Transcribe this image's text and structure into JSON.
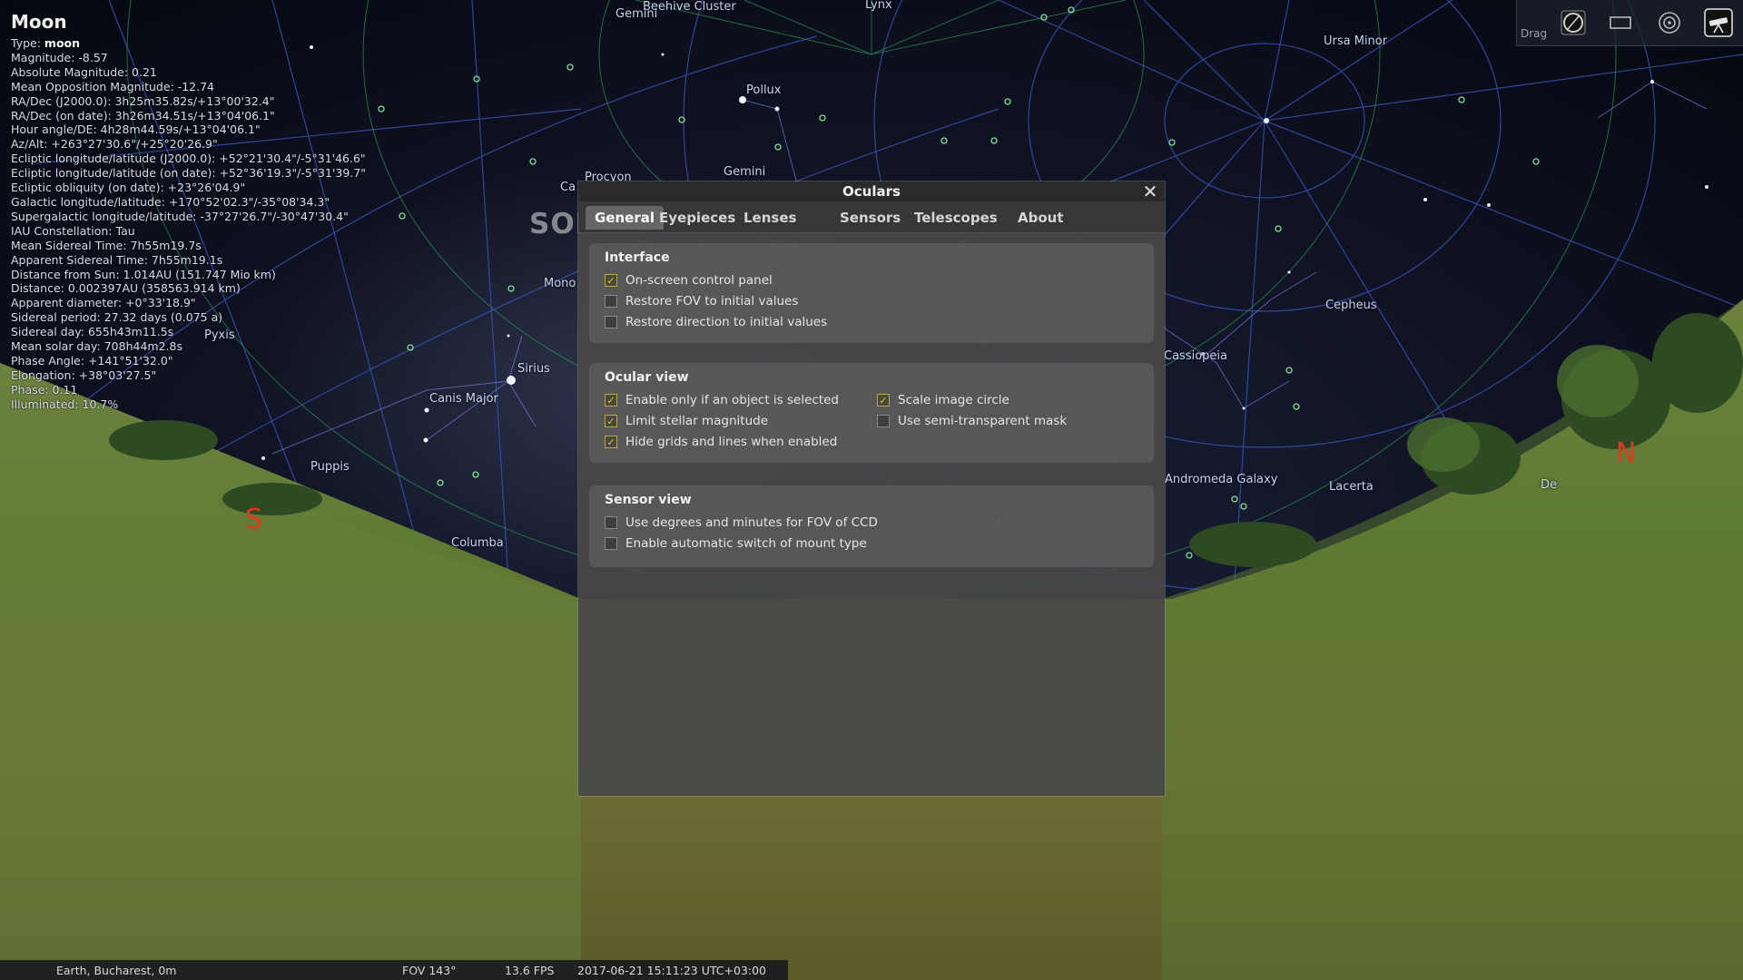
{
  "object_info": {
    "name": "Moon",
    "type_label": "Type:",
    "type_value": "moon",
    "lines": [
      "Magnitude: -8.57",
      "Absolute Magnitude: 0.21",
      "Mean Opposition Magnitude: -12.74",
      "RA/Dec (J2000.0): 3h25m35.82s/+13°00'32.4\"",
      "RA/Dec (on date): 3h26m34.51s/+13°04'06.1\"",
      "Hour angle/DE: 4h28m44.59s/+13°04'06.1\"",
      "Az/Alt: +263°27'30.6\"/+25°20'26.9\"",
      "Ecliptic longitude/latitude (J2000.0): +52°21'30.4\"/-5°31'46.6\"",
      "Ecliptic longitude/latitude (on date): +52°36'19.3\"/-5°31'39.7\"",
      "Ecliptic obliquity (on date): +23°26'04.9\"",
      "Galactic longitude/latitude: +170°52'02.3\"/-35°08'34.3\"",
      "Supergalactic longitude/latitude: -37°27'26.7\"/-30°47'30.4\"",
      "IAU Constellation: Tau",
      "Mean Sidereal Time: 7h55m19.7s",
      "Apparent Sidereal Time: 7h55m19.1s",
      "Distance from Sun: 1.014AU (151.747 Mio km)",
      "Distance: 0.002397AU (358563.914 km)",
      "Apparent diameter: +0°33'18.9\"",
      "Sidereal period: 27.32 days (0.075 a)",
      "Sidereal day: 655h43m11.5s",
      "Mean solar day: 708h44m2.8s",
      "Phase Angle: +141°51'32.0\"",
      "Elongation: +38°03'27.5\"",
      "Phase: 0.11",
      "Illuminated: 10.7%"
    ]
  },
  "toolbar": {
    "drag_label": "Drag",
    "icons": [
      "ocular-icon",
      "sensor-frame-icon",
      "telrad-icon",
      "telescope-icon"
    ]
  },
  "sky_labels": {
    "beehive": "Beehive Cluster",
    "gemini_top": "Gemini",
    "lynx": "Lynx",
    "ursa_minor": "Ursa Minor",
    "pollux": "Pollux",
    "procyon": "Procyon",
    "gemini": "Gemini",
    "cancer": "Ca",
    "monoceros": "Mono",
    "pyxis": "Pyxis",
    "sirius": "Sirius",
    "canis_major": "Canis Major",
    "puppis": "Puppis",
    "columba": "Columba",
    "cepheus": "Cepheus",
    "cassiopeia": "Cassiopeia",
    "andromeda_galaxy": "Andromeda Galaxy",
    "lacerta": "Lacerta",
    "de": "De",
    "south": "S",
    "north": "N"
  },
  "watermark": "SOFTPEDIA",
  "dialog": {
    "title": "Oculars",
    "close_glyph": "✕",
    "tabs": [
      "General",
      "Eyepieces",
      "Lenses",
      "Sensors",
      "Telescopes",
      "About"
    ],
    "active_tab": "General",
    "groups": {
      "interface": {
        "title": "Interface",
        "options": [
          {
            "label": "On-screen control panel",
            "checked": true
          },
          {
            "label": "Restore FOV to initial values",
            "checked": false
          },
          {
            "label": "Restore direction to initial values",
            "checked": false
          }
        ]
      },
      "ocular_view": {
        "title": "Ocular view",
        "options": [
          {
            "label": "Enable only if an object is selected",
            "checked": true
          },
          {
            "label": "Limit stellar magnitude",
            "checked": true
          },
          {
            "label": "Hide grids and lines when enabled",
            "checked": true
          },
          {
            "label": "Scale image circle",
            "checked": true
          },
          {
            "label": "Use semi-transparent mask",
            "checked": false
          }
        ]
      },
      "sensor_view": {
        "title": "Sensor view",
        "options": [
          {
            "label": "Use degrees and minutes for FOV of CCD",
            "checked": false
          },
          {
            "label": "Enable automatic switch of mount type",
            "checked": false
          }
        ]
      }
    }
  },
  "status_bar": {
    "location": "Earth, Bucharest, 0m",
    "fov": "FOV 143°",
    "fps": "13.6 FPS",
    "datetime": "2017-06-21 15:11:23 UTC+03:00"
  },
  "colors": {
    "accent_check": "#e6c23a",
    "compass": "#e23a20",
    "grid_equatorial": "#3a4fb0",
    "grid_azimuthal": "#2f8a55"
  }
}
